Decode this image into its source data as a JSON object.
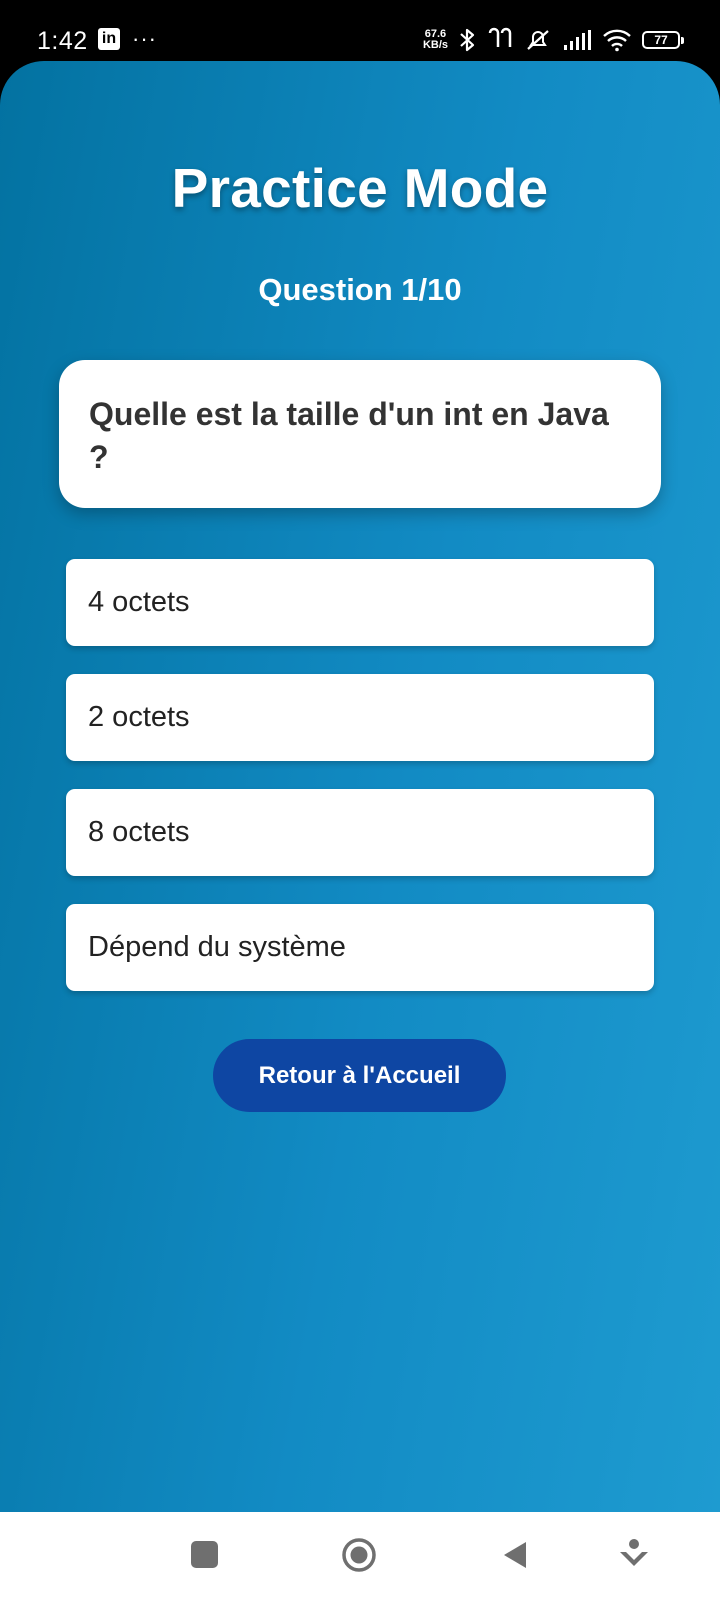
{
  "status_bar": {
    "time": "1:42",
    "linkedin_icon": "linkedin-icon",
    "more_dots": "···",
    "net_speed_value": "67.6",
    "net_speed_unit": "KB/s",
    "battery_level": "77"
  },
  "app": {
    "title": "Practice Mode",
    "question_counter": "Question 1/10",
    "question_text": "Quelle est la taille d'un int en Java ?",
    "options": [
      {
        "label": "4 octets"
      },
      {
        "label": "2 octets"
      },
      {
        "label": "8 octets"
      },
      {
        "label": "Dépend du système"
      }
    ],
    "home_button_label": "Retour à l'Accueil"
  },
  "colors": {
    "background_gradient_start": "#0372a1",
    "background_gradient_end": "#1e9bd0",
    "button_primary": "#0e46a3",
    "card": "#ffffff"
  },
  "nav_bar": {
    "icons": [
      "recents-square-icon",
      "home-circle-icon",
      "back-triangle-icon",
      "assistant-icon"
    ]
  }
}
